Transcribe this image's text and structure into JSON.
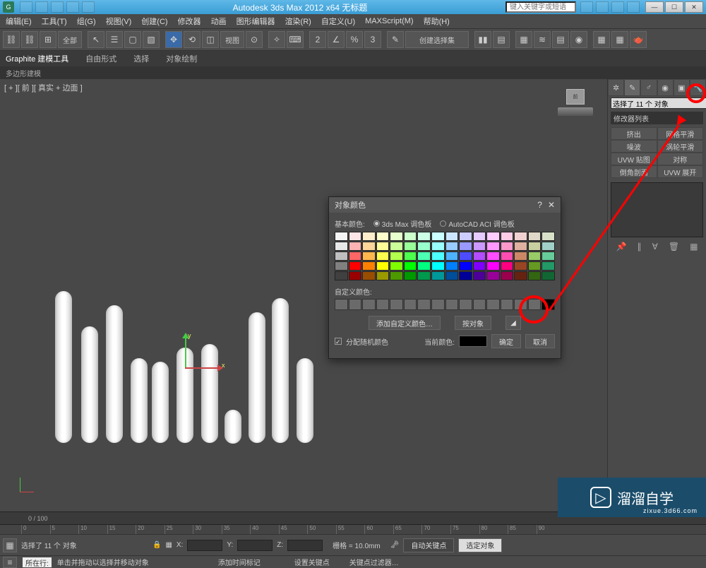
{
  "titlebar": {
    "app_title": "Autodesk 3ds Max  2012 x64     无标题",
    "search_placeholder": "键入关键字或短语"
  },
  "menu": [
    "编辑(E)",
    "工具(T)",
    "组(G)",
    "视图(V)",
    "创建(C)",
    "修改器",
    "动画",
    "图形编辑器",
    "渲染(R)",
    "自定义(U)",
    "MAXScript(M)",
    "帮助(H)"
  ],
  "toolbar": {
    "all_label": "全部",
    "view_label": "视图",
    "create_set": "创建选择集"
  },
  "ribbon": {
    "tabs": [
      "Graphite 建模工具",
      "自由形式",
      "选择",
      "对象绘制"
    ],
    "sub": "多边形建模"
  },
  "viewport": {
    "label": "[ + ][ 前 ][ 真实 + 边面 ]",
    "cube_face": "前"
  },
  "cmdpanel": {
    "selection_text": "选择了 11 个 对象",
    "modlist": "修改器列表",
    "mods": [
      "挤出",
      "网格平滑",
      "噪波",
      "涡轮平滑",
      "UVW 贴图",
      "对称",
      "倒角剖面",
      "UVW 展开"
    ]
  },
  "colordlg": {
    "title": "对象颜色",
    "basic": "基本颜色:",
    "palette_3ds": "3ds Max 调色板",
    "palette_acad": "AutoCAD ACI 调色板",
    "custom": "自定义颜色:",
    "add_custom": "添加自定义颜色…",
    "by_object": "按对象",
    "random": "分配随机颜色",
    "current": "当前颜色:",
    "ok": "确定",
    "cancel": "取消"
  },
  "status": {
    "frame": "0 / 100",
    "sel": "选择了 11 个 对象",
    "x": "X:",
    "y": "Y:",
    "z": "Z:",
    "grid": "栅格 = 10.0mm",
    "autokey": "自动关键点",
    "selfilter": "选定对象",
    "setkey": "设置关键点",
    "keyfilter": "关键点过滤器…",
    "prompt_label": "所在行:",
    "prompt": "单击并拖动以选择并移动对象",
    "addtime": "添加时间标记"
  },
  "watermark": {
    "brand": "溜溜自学",
    "url": "zixue.3d66.com"
  },
  "palette_colors": [
    "#f5f5f5",
    "#ffe6e6",
    "#ffeecc",
    "#ffffcc",
    "#e6ffcc",
    "#ccffcc",
    "#ccffe6",
    "#ccffff",
    "#cce6ff",
    "#ccccff",
    "#e6ccff",
    "#ffccff",
    "#ffcce6",
    "#f0d0d0",
    "#e0d8c8",
    "#d8e0c8",
    "#e8e8e8",
    "#ffb3b3",
    "#ffd699",
    "#ffff99",
    "#ccff99",
    "#99ff99",
    "#99ffcc",
    "#99ffff",
    "#99ccff",
    "#9999ff",
    "#cc99ff",
    "#ff99ff",
    "#ff99cc",
    "#e0b0a0",
    "#c8d0a0",
    "#a0d0c8",
    "#bfbfbf",
    "#ff6666",
    "#ffb84d",
    "#ffff4d",
    "#b3ff4d",
    "#4dff4d",
    "#4dffb3",
    "#4dffff",
    "#4db2ff",
    "#4d4dff",
    "#b34dff",
    "#ff4dff",
    "#ff4db2",
    "#cc8866",
    "#99cc66",
    "#66cc99",
    "#808080",
    "#ff0000",
    "#ff8000",
    "#ffff00",
    "#80ff00",
    "#00ff00",
    "#00ff80",
    "#00ffff",
    "#0080ff",
    "#0000ff",
    "#8000ff",
    "#ff00ff",
    "#ff0080",
    "#994422",
    "#669922",
    "#229966",
    "#404040",
    "#990000",
    "#994d00",
    "#999900",
    "#4d9900",
    "#009900",
    "#00994d",
    "#009999",
    "#004d99",
    "#000099",
    "#4d0099",
    "#990099",
    "#99004d",
    "#662211",
    "#336611",
    "#116633"
  ]
}
